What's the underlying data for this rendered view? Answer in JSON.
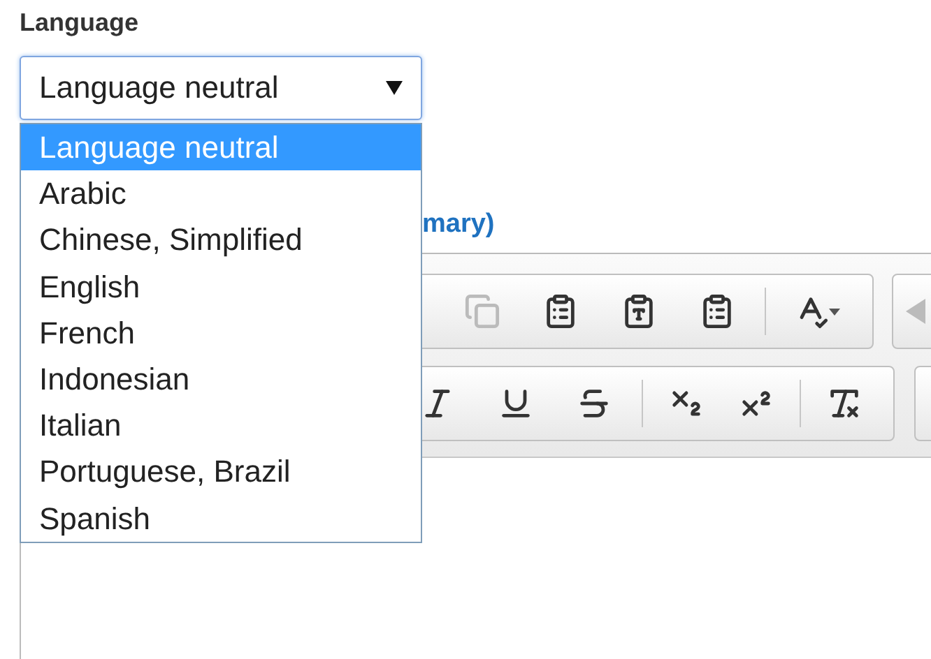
{
  "field": {
    "label": "Language",
    "value": "Language neutral"
  },
  "dropdown": {
    "expanded": true,
    "options": [
      {
        "label": "Language neutral",
        "selected": true
      },
      {
        "label": "Arabic",
        "selected": false
      },
      {
        "label": "Chinese, Simplified",
        "selected": false
      },
      {
        "label": "English",
        "selected": false
      },
      {
        "label": "French",
        "selected": false
      },
      {
        "label": "Indonesian",
        "selected": false
      },
      {
        "label": "Italian",
        "selected": false
      },
      {
        "label": "Portuguese, Brazil",
        "selected": false
      },
      {
        "label": "Spanish",
        "selected": false
      }
    ]
  },
  "editor": {
    "heading": "mary)"
  }
}
